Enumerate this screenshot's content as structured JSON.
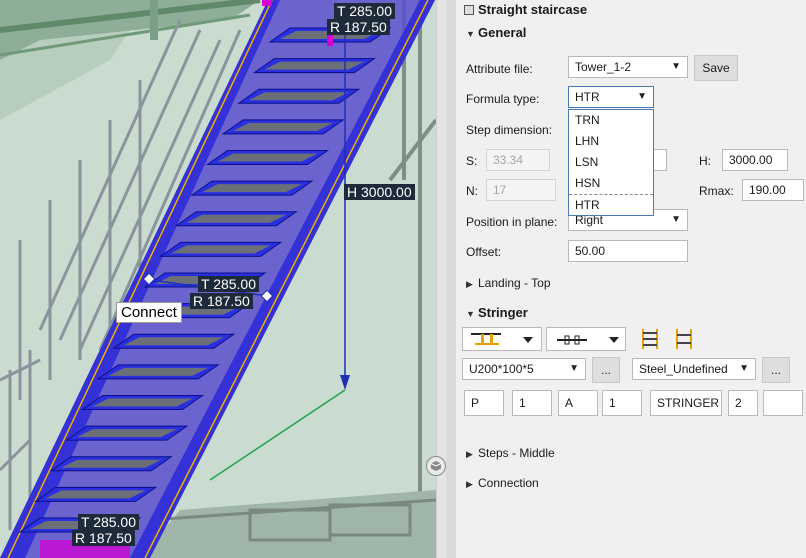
{
  "viewport": {
    "dimensions": [
      {
        "t": "T 285.00",
        "r": "R 187.50"
      },
      {
        "t": "T 285.00",
        "r": "R 187.50"
      },
      {
        "t": "T 285.00",
        "r": "R 187.50"
      }
    ],
    "height_label": "H 3000.00",
    "connect_label": "Connect"
  },
  "panel": {
    "title": "Straight staircase",
    "general": {
      "header": "General",
      "attribute_file_label": "Attribute file:",
      "attribute_file_value": "Tower_1-2",
      "save_label": "Save",
      "formula_type_label": "Formula type:",
      "formula_type_value": "HTR",
      "formula_options": [
        "TRN",
        "LHN",
        "LSN",
        "HSN",
        "HTR"
      ],
      "step_dimension_label": "Step dimension:",
      "s_label": "S:",
      "s_value": "33.34",
      "n_label": "N:",
      "n_value": "17",
      "h_label": "H:",
      "h_value": "3000.00",
      "rmax_label": "Rmax:",
      "rmax_value": "190.00",
      "position_label": "Position in plane:",
      "position_value": "Right",
      "offset_label": "Offset:",
      "offset_value": "50.00"
    },
    "landing_top": "Landing - Top",
    "stringer": {
      "header": "Stringer",
      "profile_value": "U200*100*5",
      "material_value": "Steel_Undefined",
      "browse_label": "...",
      "numbering": [
        "P",
        "1",
        "A",
        "1",
        "STRINGER",
        "2",
        ""
      ]
    },
    "steps_middle": "Steps - Middle",
    "connection": "Connection"
  },
  "colors": {
    "stair_blue": "#2f2fd6",
    "stair_fill": "#5a4fcf",
    "dimension_bg": "#1c2a3a",
    "structure_green": "#7fa089",
    "handle_magenta": "#d400d4"
  }
}
